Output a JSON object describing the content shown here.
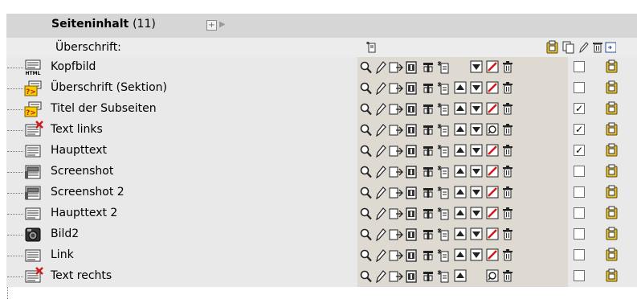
{
  "section": {
    "title": "Seiteninhalt",
    "count": "(11)"
  },
  "columns": {
    "header_label": "Überschrift:"
  },
  "rows": [
    {
      "label": "Kopfbild",
      "type_icon": "html-icon",
      "hidden_icon": false,
      "checked": false,
      "move_up": false,
      "move_down": true,
      "toggle_state": "hide"
    },
    {
      "label": "Überschrift (Sektion)",
      "type_icon": "header-icon",
      "hidden_icon": false,
      "checked": false,
      "move_up": true,
      "move_down": true,
      "toggle_state": "hide"
    },
    {
      "label": "Titel der Subseiten",
      "type_icon": "header-icon",
      "hidden_icon": false,
      "checked": true,
      "move_up": true,
      "move_down": true,
      "toggle_state": "hide"
    },
    {
      "label": "Text links",
      "type_icon": "text-icon",
      "hidden_icon": true,
      "checked": true,
      "move_up": true,
      "move_down": true,
      "toggle_state": "unhide"
    },
    {
      "label": "Haupttext",
      "type_icon": "text-icon",
      "hidden_icon": false,
      "checked": true,
      "move_up": true,
      "move_down": true,
      "toggle_state": "hide"
    },
    {
      "label": "Screenshot",
      "type_icon": "textpic-icon",
      "hidden_icon": false,
      "checked": false,
      "move_up": true,
      "move_down": true,
      "toggle_state": "hide"
    },
    {
      "label": "Screenshot 2",
      "type_icon": "textpic-icon",
      "hidden_icon": false,
      "checked": false,
      "move_up": true,
      "move_down": true,
      "toggle_state": "hide"
    },
    {
      "label": "Haupttext 2",
      "type_icon": "text-icon",
      "hidden_icon": false,
      "checked": false,
      "move_up": true,
      "move_down": true,
      "toggle_state": "hide"
    },
    {
      "label": "Bild2",
      "type_icon": "image-icon",
      "hidden_icon": false,
      "checked": false,
      "move_up": true,
      "move_down": true,
      "toggle_state": "hide"
    },
    {
      "label": "Link",
      "type_icon": "text-icon",
      "hidden_icon": false,
      "checked": false,
      "move_up": true,
      "move_down": true,
      "toggle_state": "hide"
    },
    {
      "label": "Text rechts",
      "type_icon": "text-icon",
      "hidden_icon": true,
      "checked": false,
      "move_up": true,
      "move_down": false,
      "toggle_state": "unhide"
    }
  ],
  "colors": {
    "header_band": "#d6d6d6",
    "row_bg": "#e9e9e9",
    "control_bg": "#dedad2",
    "clipboard": "#e8c33a",
    "delete_red": "#d41818"
  }
}
